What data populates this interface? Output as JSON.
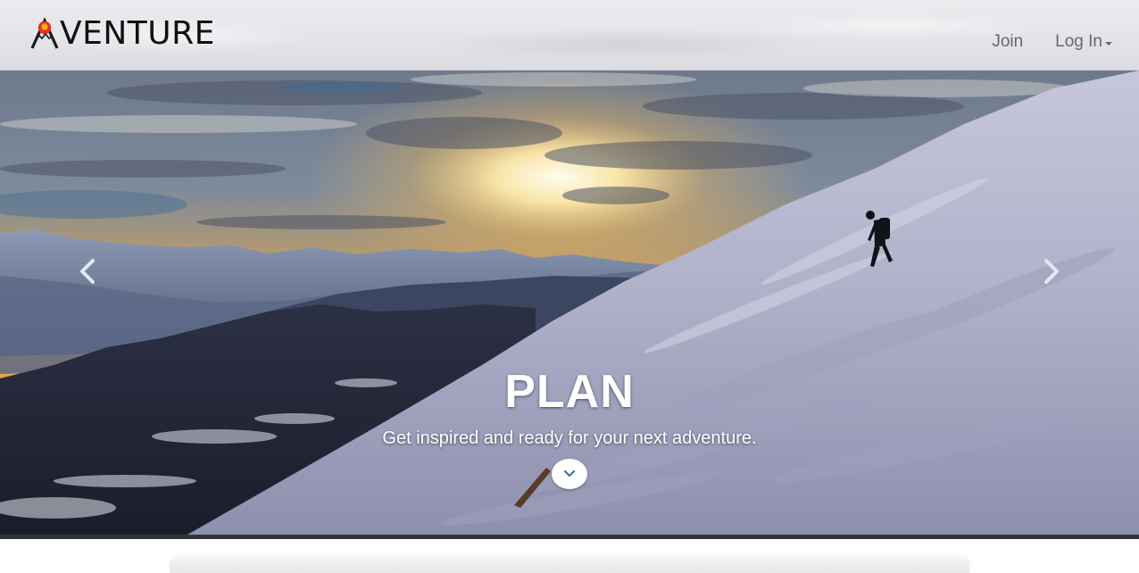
{
  "brand": {
    "name": "VENTURE",
    "accent_colors": [
      "#e8302a",
      "#f6b800",
      "#1a1a1a"
    ]
  },
  "nav": {
    "join_label": "Join",
    "login_label": "Log In"
  },
  "carousel": {
    "slide": {
      "title": "PLAN",
      "subtitle": "Get inspired and ready for your next adventure."
    },
    "prev_icon": "chevron-left-icon",
    "next_icon": "chevron-right-icon",
    "scroll_icon": "chevron-down-icon",
    "scroll_icon_color": "#2a6fa8"
  }
}
